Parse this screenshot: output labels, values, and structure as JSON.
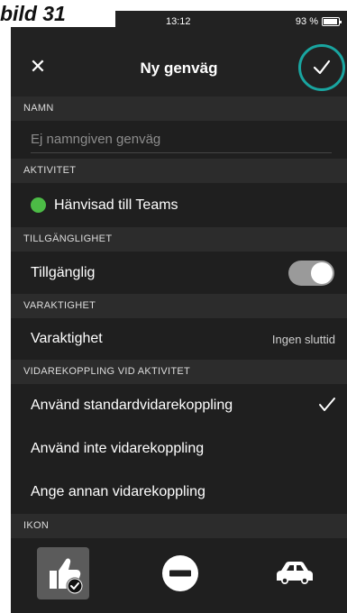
{
  "caption": "bild 31",
  "status_bar": {
    "time": "13:12",
    "battery": "93 %"
  },
  "navbar": {
    "title": "Ny genväg",
    "close_glyph": "✕"
  },
  "sections": {
    "name": "NAMN",
    "activity": "AKTIVITET",
    "availability": "TILLGÄNGLIGHET",
    "duration": "VARAKTIGHET",
    "forwarding": "VIDAREKOPPLING VID AKTIVITET",
    "icon": "IKON"
  },
  "name_field": {
    "placeholder": "Ej namngiven genväg",
    "value": ""
  },
  "activity": {
    "label": "Hänvisad till Teams",
    "status_color": "#4cbb46"
  },
  "availability": {
    "label": "Tillgänglig",
    "toggle_on": true
  },
  "duration": {
    "label": "Varaktighet",
    "value": "Ingen sluttid"
  },
  "forwarding_options": [
    {
      "label": "Använd standardvidarekoppling",
      "selected": true
    },
    {
      "label": "Använd inte vidarekoppling",
      "selected": false
    },
    {
      "label": "Ange annan vidarekoppling",
      "selected": false
    }
  ],
  "icons": [
    {
      "name": "thumbs-up-icon",
      "selected": true
    },
    {
      "name": "do-not-disturb-icon",
      "selected": false
    },
    {
      "name": "car-icon",
      "selected": false
    }
  ],
  "colors": {
    "accent": "#19a5a0",
    "background": "#222222",
    "section": "#2c2c2c"
  }
}
